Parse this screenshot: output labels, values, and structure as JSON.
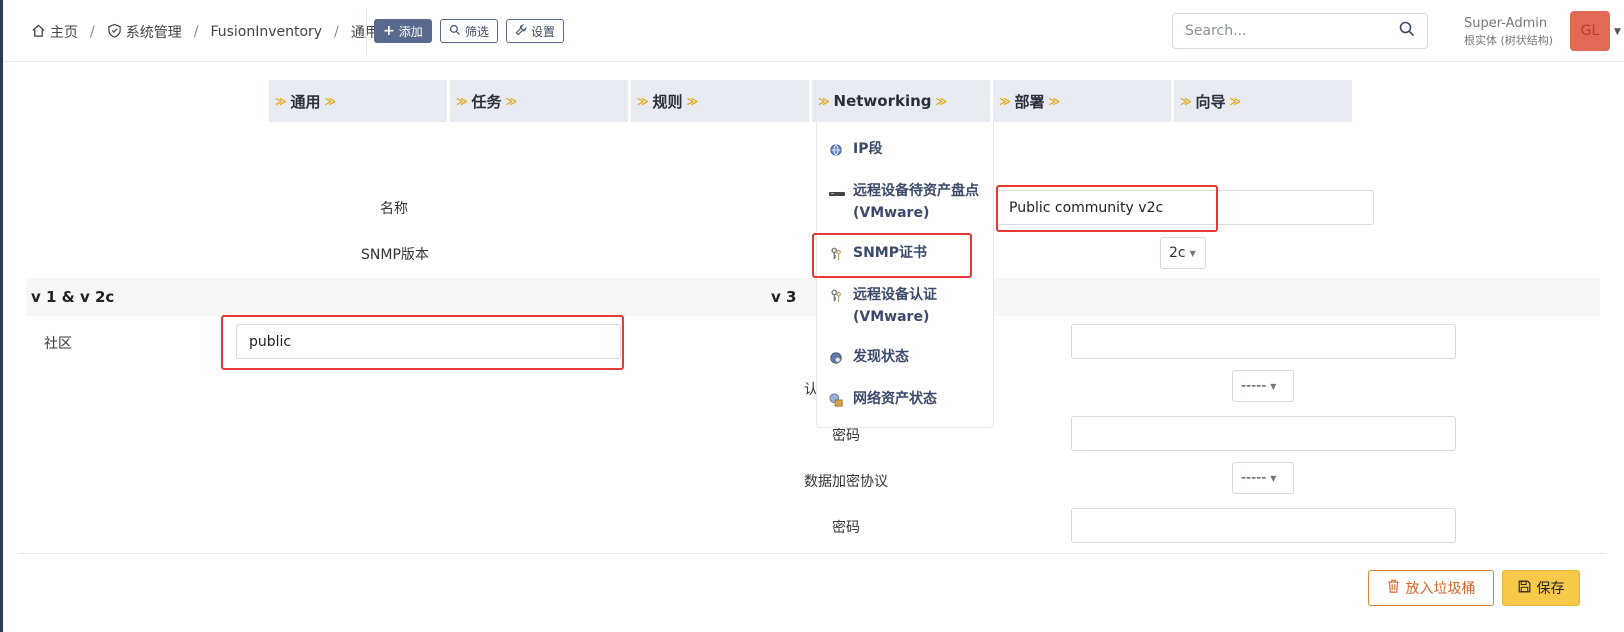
{
  "breadcrumb": {
    "home": "主页",
    "admin": "系统管理",
    "plugin": "FusionInventory",
    "current": "通用"
  },
  "toolbar": {
    "add_label": "添加",
    "filter_label": "筛选",
    "settings_label": "设置"
  },
  "search": {
    "placeholder": "Search..."
  },
  "user": {
    "name": "Super-Admin",
    "entity": "根实体 (树状结构)",
    "initials": "GL"
  },
  "tabs": [
    {
      "label": "通用"
    },
    {
      "label": "任务"
    },
    {
      "label": "规则"
    },
    {
      "label": "Networking"
    },
    {
      "label": "部署"
    },
    {
      "label": "向导"
    }
  ],
  "networking_menu": {
    "items": [
      {
        "label": "IP段",
        "icon": "globe-icon"
      },
      {
        "label": "远程设备待资产盘点 (VMware)",
        "icon": "device-icon"
      },
      {
        "label": "SNMP证书",
        "icon": "keys-icon"
      },
      {
        "label": "远程设备认证 (VMware)",
        "icon": "keys-icon"
      },
      {
        "label": "发现状态",
        "icon": "discovery-icon"
      },
      {
        "label": "网络资产状态",
        "icon": "inventory-icon"
      }
    ]
  },
  "form": {
    "name_label": "名称",
    "name_value": "Public community v2c",
    "snmp_version_label": "SNMP版本",
    "snmp_version_value": "2c",
    "section_v1v2c": "v 1 & v 2c",
    "section_v3": "v 3",
    "community_label": "社区",
    "community_value": "public",
    "auth_label_partial": "认",
    "auth_protocol_value": "-----",
    "password_label_partial": "密码",
    "encryption_label": "数据加密协议",
    "encryption_value": "-----",
    "password_label": "密码"
  },
  "actions": {
    "trash_label": "放入垃圾桶",
    "save_label": "保存"
  },
  "colors": {
    "accent": "#5a6a8e",
    "highlight": "#e53935",
    "save": "#f7c948",
    "trash": "#e0833e"
  }
}
